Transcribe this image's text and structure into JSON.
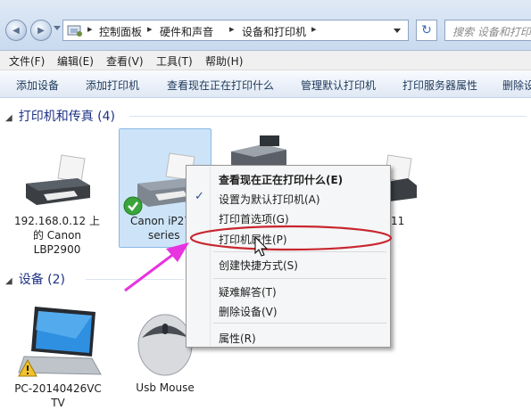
{
  "nav": {
    "back_glyph": "◀",
    "forward_glyph": "▶",
    "refresh_glyph": "↻"
  },
  "address": {
    "crumbs": [
      "控制面板",
      "硬件和声音",
      "设备和打印机"
    ],
    "separator": "▸"
  },
  "search": {
    "placeholder": "搜索 设备和打印机"
  },
  "menubar": [
    "文件(F)",
    "编辑(E)",
    "查看(V)",
    "工具(T)",
    "帮助(H)"
  ],
  "commands": [
    "添加设备",
    "添加打印机",
    "查看现在正在打印什么",
    "管理默认打印机",
    "打印服务器属性",
    "删除设"
  ],
  "groups": {
    "printers": {
      "tri": "◢",
      "title": "打印机和传真 (4)"
    },
    "devices": {
      "tri": "◢",
      "title": "设备 (2)"
    }
  },
  "printers": [
    {
      "line1": "192.168.0.12 上",
      "line2": "的 Canon",
      "line3": "LBP2900"
    },
    {
      "line1": "Canon iP27",
      "line2": "series",
      "default": true
    },
    {
      "line1": "",
      "line2": ""
    },
    {
      "line1": "11",
      "line2": ""
    }
  ],
  "devices": [
    {
      "line1": "PC-20140426VC",
      "line2": "TV",
      "warning": true
    },
    {
      "line1": "Usb Mouse"
    }
  ],
  "context_menu": {
    "items": [
      {
        "label": "查看现在正在打印什么(E)",
        "bold": true
      },
      {
        "label": "设置为默认打印机(A)",
        "checked": true
      },
      {
        "label": "打印首选项(G)"
      },
      {
        "label": "打印机属性(P)",
        "highlighted": true
      },
      {
        "label": "创建快捷方式(S)"
      },
      {
        "label": "疑难解答(T)"
      },
      {
        "label": "删除设备(V)"
      },
      {
        "label": "属性(R)"
      }
    ],
    "check_glyph": "✓"
  },
  "colors": {
    "annotation_ellipse": "#c8262f",
    "annotation_arrow": "#e733e0",
    "selection": "#cde4f8",
    "group_title": "#1e3287"
  }
}
